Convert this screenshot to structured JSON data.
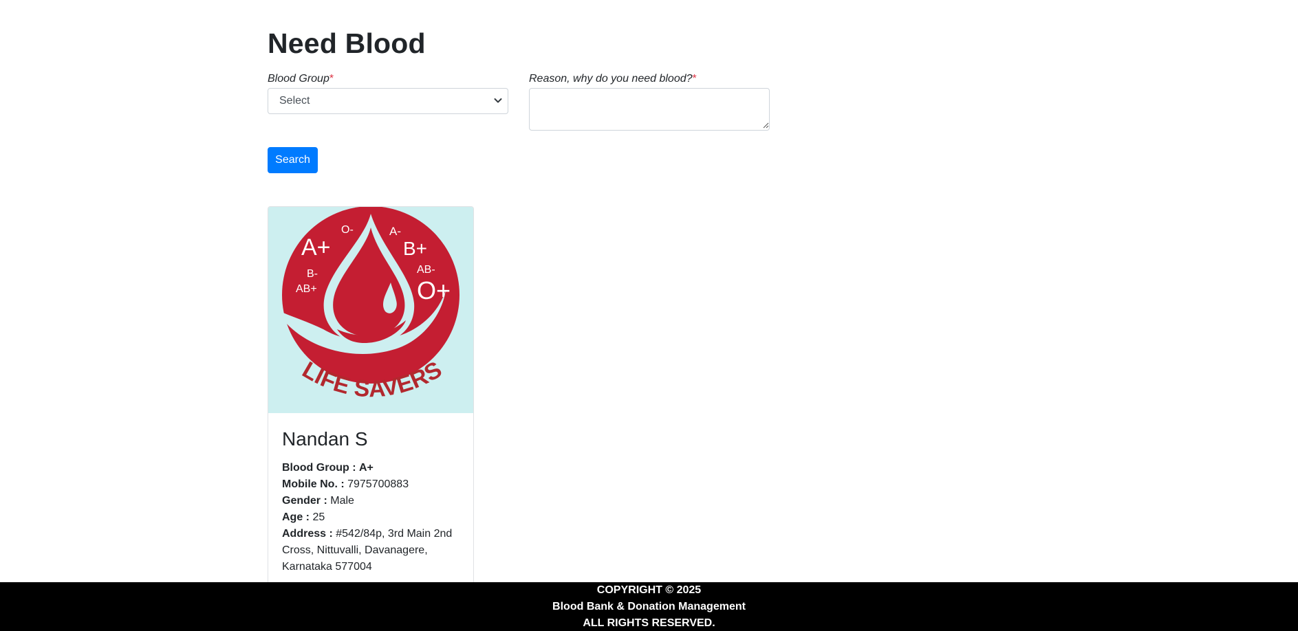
{
  "page": {
    "title": "Need Blood"
  },
  "form": {
    "blood_group_label": "Blood Group",
    "reason_label": "Reason, why do you need blood?",
    "required_mark": "*",
    "blood_group_selected": "Select",
    "reason_value": "",
    "search_label": "Search"
  },
  "donor_card": {
    "logo": {
      "groups": [
        "A+",
        "O-",
        "A-",
        "B+",
        "AB-",
        "B-",
        "AB+",
        "O+"
      ],
      "text": "LIFE SAVERS",
      "background_color": "#cdeff0",
      "red_color": "#c41e32"
    },
    "name": "Nandan S",
    "blood_group_label": "Blood Group :",
    "blood_group_value": "A+",
    "mobile_label": "Mobile No. :",
    "mobile_value": "7975700883",
    "gender_label": "Gender :",
    "gender_value": "Male",
    "age_label": "Age :",
    "age_value": "25",
    "address_label": "Address :",
    "address_value": "#542/84p, 3rd Main 2nd Cross, Nittuvalli, Davanagere, Karnataka 577004"
  },
  "footer": {
    "line1": "COPYRIGHT © 2025",
    "line2": "Blood Bank & Donation Management",
    "line3": "ALL RIGHTS RESERVED."
  },
  "colors": {
    "primary": "#007bff",
    "required": "#dc3545",
    "footer_bg": "#000000"
  }
}
